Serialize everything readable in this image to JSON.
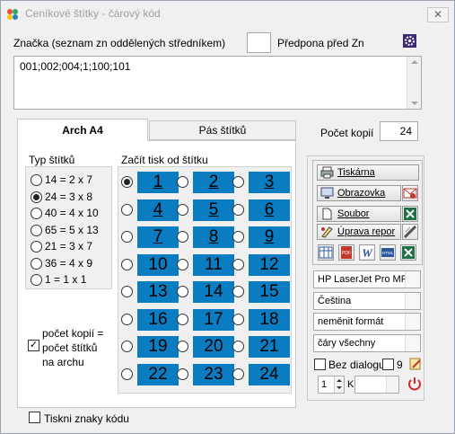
{
  "window": {
    "title": "Ceníkové štítky - čárový kód",
    "close_glyph": "✕"
  },
  "top": {
    "brand_label": "Značka (seznam zn oddělených středníkem)",
    "prefix_label": "Předpona před Zn",
    "prefix_value": "",
    "codes_value": "001;002;004;1;100;101"
  },
  "tabs": [
    {
      "label": "Arch A4",
      "active": true
    },
    {
      "label": "Pás štítků",
      "active": false
    }
  ],
  "copies": {
    "label": "Počet kopií",
    "value": "24"
  },
  "label_type": {
    "heading": "Typ štítků",
    "options": [
      {
        "label": "14 = 2 x 7",
        "selected": false
      },
      {
        "label": "24 = 3 x 8",
        "selected": true
      },
      {
        "label": "40 = 4 x 10",
        "selected": false
      },
      {
        "label": "65 = 5 x 13",
        "selected": false
      },
      {
        "label": "21 = 3 x 7",
        "selected": false
      },
      {
        "label": "36 = 4 x 9",
        "selected": false
      },
      {
        "label": "1 = 1 x 1",
        "selected": false
      }
    ]
  },
  "copies_check": {
    "label_line1": "počet kopií =",
    "label_line2": "počet štítků",
    "label_line3": "na archu",
    "checked": true
  },
  "start": {
    "heading": "Začít tisk od štítku",
    "cells": [
      "1",
      "2",
      "3",
      "4",
      "5",
      "6",
      "7",
      "8",
      "9",
      "10",
      "11",
      "12",
      "13",
      "14",
      "15",
      "16",
      "17",
      "18",
      "19",
      "20",
      "21",
      "22",
      "23",
      "24"
    ],
    "selected": "1"
  },
  "print_chars": {
    "label": "Tiskni znaky kódu",
    "checked": false
  },
  "output": {
    "printer_button": "Tiskárna",
    "screen_button": "Obrazovka",
    "file_button": "Soubor",
    "edit_report_button": "Úprava repor",
    "pdf_label": "PDF",
    "html_label": "HTML"
  },
  "combos": {
    "printer": "HP LaserJet Pro MFP",
    "language": "Čeština",
    "format": "neměnit formát",
    "lines": "čáry všechny"
  },
  "bottom_opts": {
    "no_dialog_label": "Bez dialogu",
    "no_dialog_checked": false,
    "nine_label": "9",
    "nine_checked": false,
    "copies_spin": "1",
    "k_label": "K",
    "k_value": ""
  }
}
